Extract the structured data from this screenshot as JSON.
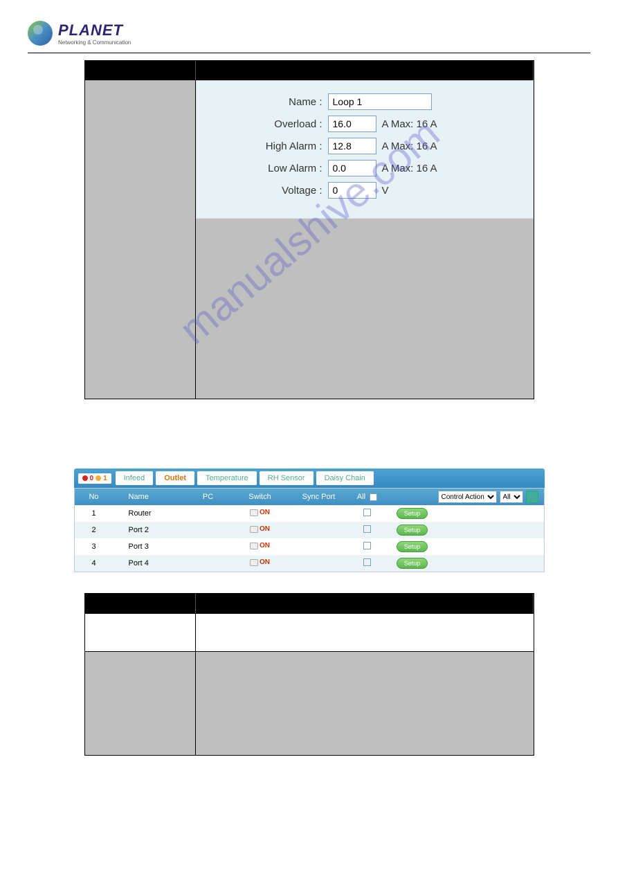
{
  "brand": {
    "name": "PLANET",
    "tagline": "Networking & Communication"
  },
  "watermark": "manualshive.com",
  "form": {
    "name_label": "Name :",
    "name_value": "Loop 1",
    "overload_label": "Overload :",
    "overload_value": "16.0",
    "overload_suffix": "A  Max: 16 A",
    "high_alarm_label": "High Alarm :",
    "high_alarm_value": "12.8",
    "high_alarm_suffix": "A  Max: 16 A",
    "low_alarm_label": "Low Alarm :",
    "low_alarm_value": "0.0",
    "low_alarm_suffix": "A  Max: 16 A",
    "voltage_label": "Voltage :",
    "voltage_value": "0",
    "voltage_suffix": "V"
  },
  "status": {
    "count1": "0",
    "count2": "1"
  },
  "tabs": {
    "infeed": "Infeed",
    "outlet": "Outlet",
    "temperature": "Temperature",
    "rh_sensor": "RH Sensor",
    "daisy_chain": "Daisy Chain"
  },
  "outlet_header": {
    "no": "No",
    "name": "Name",
    "pc": "PC",
    "switch": "Switch",
    "sync": "Sync Port",
    "all": "All",
    "control_action": "Control Action",
    "all_opt": "All"
  },
  "outlets": [
    {
      "no": "1",
      "name": "Router",
      "switch": "ON",
      "setup": "Setup"
    },
    {
      "no": "2",
      "name": "Port 2",
      "switch": "ON",
      "setup": "Setup"
    },
    {
      "no": "3",
      "name": "Port 3",
      "switch": "ON",
      "setup": "Setup"
    },
    {
      "no": "4",
      "name": "Port 4",
      "switch": "ON",
      "setup": "Setup"
    }
  ]
}
